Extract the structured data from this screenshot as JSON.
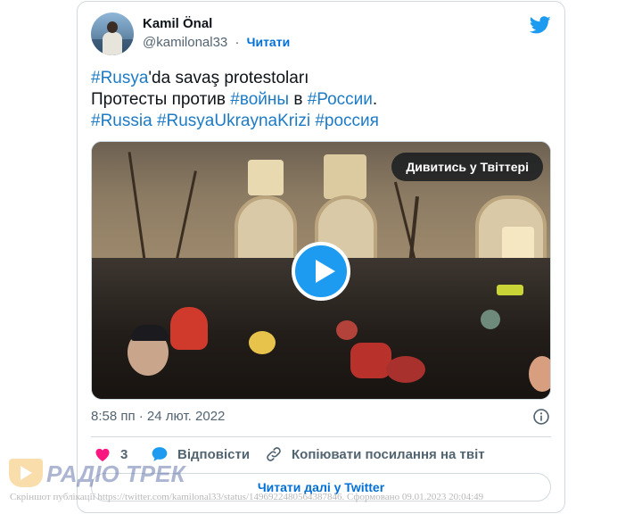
{
  "tweet": {
    "author_name": "Kamil Önal",
    "author_handle": "@kamilonal33",
    "separator": "·",
    "follow_label": "Читати",
    "text_lines": [
      [
        {
          "t": "#Rusya",
          "tag": true
        },
        {
          "t": "'da savaş protestoları",
          "tag": false
        }
      ],
      [
        {
          "t": "Протесты против ",
          "tag": false
        },
        {
          "t": "#войны",
          "tag": true
        },
        {
          "t": " в ",
          "tag": false
        },
        {
          "t": "#России",
          "tag": true
        },
        {
          "t": ".",
          "tag": false
        }
      ],
      [
        {
          "t": "#Russia",
          "tag": true
        },
        {
          "t": " ",
          "tag": false
        },
        {
          "t": "#RusyaUkraynaKrizi",
          "tag": true
        },
        {
          "t": " ",
          "tag": false
        },
        {
          "t": "#россия",
          "tag": true
        }
      ]
    ],
    "watch_label": "Дивитись у Твіттері",
    "timestamp": "8:58 пп · 24 лют. 2022",
    "likes_count": "3",
    "reply_label": "Відповісти",
    "copy_link_label": "Копіювати посилання на твіт",
    "read_more_label": "Читати далі у Twitter"
  },
  "colors": {
    "accent": "#1d9bf0",
    "link": "#1d7bc6",
    "like": "#f91880",
    "muted": "#536471"
  },
  "icons": {
    "brand": "twitter-bird-icon",
    "play": "play-icon",
    "info": "info-icon",
    "like": "heart-icon",
    "reply": "speech-bubble-icon",
    "copy": "link-icon"
  },
  "watermark": {
    "logo_text": "РАДІО ТРЕК",
    "caption": "Скріншот публікації https://twitter.com/kamilonal33/status/1496922480564387846. Сформовано 09.01.2023 20:04:49"
  }
}
